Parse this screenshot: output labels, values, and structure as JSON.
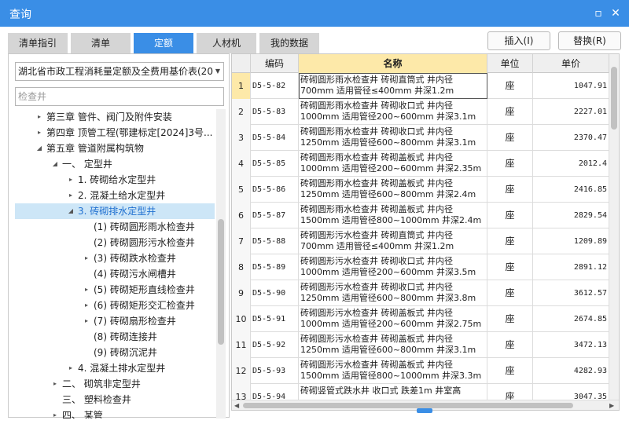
{
  "window": {
    "title": "查询",
    "maximize_glyph": "▫",
    "close_glyph": "✕"
  },
  "tabs": [
    {
      "label": "清单指引",
      "active": false
    },
    {
      "label": "清单",
      "active": false
    },
    {
      "label": "定额",
      "active": true
    },
    {
      "label": "人材机",
      "active": false
    },
    {
      "label": "我的数据",
      "active": false
    }
  ],
  "actions": {
    "insert_label": "插入(I)",
    "replace_label": "替换(R)"
  },
  "left": {
    "library_select": "湖北省市政工程消耗量定额及全费用基价表(20",
    "search_placeholder": "检查井",
    "tree": [
      {
        "label": "第三章 管件、阀门及附件安装",
        "expander": "▸"
      },
      {
        "label": "第四章 顶管工程(鄂建标定[2024]3号...",
        "expander": "▸"
      },
      {
        "label": "第五章 管道附属构筑物",
        "expander": "◢"
      },
      {
        "label": "一、 定型井",
        "expander": "◢"
      },
      {
        "label": "1. 砖砌给水定型井",
        "expander": "▸"
      },
      {
        "label": "2. 混凝土给水定型井",
        "expander": "▸"
      },
      {
        "label": "3. 砖砌排水定型井",
        "expander": "◢",
        "selected": true
      },
      {
        "label": "(1) 砖砌圆形雨水检查井",
        "expander": ""
      },
      {
        "label": "(2) 砖砌圆形污水检查井",
        "expander": ""
      },
      {
        "label": "(3) 砖砌跌水检查井",
        "expander": "▸"
      },
      {
        "label": "(4) 砖砌污水闸槽井",
        "expander": ""
      },
      {
        "label": "(5) 砖砌矩形直线检查井",
        "expander": "▸"
      },
      {
        "label": "(6) 砖砌矩形交汇检查井",
        "expander": "▸"
      },
      {
        "label": "(7) 砖砌扇形检查井",
        "expander": "▸"
      },
      {
        "label": "(8) 砖砌连接井",
        "expander": ""
      },
      {
        "label": "(9) 砖砌沉泥井",
        "expander": ""
      },
      {
        "label": "4. 混凝土排水定型井",
        "expander": "▸"
      },
      {
        "label": "二、 砌筑非定型井",
        "expander": "▸"
      },
      {
        "label": "三、 塑料检查井",
        "expander": ""
      },
      {
        "label": "四、 某管",
        "expander": "▸"
      }
    ]
  },
  "grid": {
    "columns": {
      "no": "",
      "code": "编码",
      "name": "名称",
      "unit": "单位",
      "price": "单价"
    },
    "rows": [
      {
        "no": "1",
        "code": "D5-5-82",
        "name1": "砖砌圆形雨水检查井 砖砌直筒式 井内径",
        "name2": "700mm 适用管径≤400mm 井深1.2m",
        "unit": "座",
        "price": "1047.91"
      },
      {
        "no": "2",
        "code": "D5-5-83",
        "name1": "砖砌圆形雨水检查井 砖砌收口式 井内径",
        "name2": "1000mm 适用管径200~600mm 井深3.1m",
        "unit": "座",
        "price": "2227.01"
      },
      {
        "no": "3",
        "code": "D5-5-84",
        "name1": "砖砌圆形雨水检查井 砖砌收口式 井内径",
        "name2": "1250mm 适用管径600~800mm 井深3.1m",
        "unit": "座",
        "price": "2370.47"
      },
      {
        "no": "4",
        "code": "D5-5-85",
        "name1": "砖砌圆形雨水检查井 砖砌盖板式 井内径",
        "name2": "1000mm 适用管径200~600mm 井深2.35m",
        "unit": "座",
        "price": "2012.4"
      },
      {
        "no": "5",
        "code": "D5-5-86",
        "name1": "砖砌圆形雨水检查井 砖砌盖板式 井内径",
        "name2": "1250mm 适用管径600~800mm 井深2.4m",
        "unit": "座",
        "price": "2416.85"
      },
      {
        "no": "6",
        "code": "D5-5-87",
        "name1": "砖砌圆形雨水检查井 砖砌盖板式 井内径",
        "name2": "1500mm 适用管径800~1000mm 井深2.4m",
        "unit": "座",
        "price": "2829.54"
      },
      {
        "no": "7",
        "code": "D5-5-88",
        "name1": "砖砌圆形污水检查井 砖砌直筒式 井内径",
        "name2": "700mm 适用管径≤400mm 井深1.2m",
        "unit": "座",
        "price": "1209.89"
      },
      {
        "no": "8",
        "code": "D5-5-89",
        "name1": "砖砌圆形污水检查井 砖砌收口式 井内径",
        "name2": "1000mm 适用管径200~600mm 井深3.5m",
        "unit": "座",
        "price": "2891.12"
      },
      {
        "no": "9",
        "code": "D5-5-90",
        "name1": "砖砌圆形污水检查井 砖砌收口式 井内径",
        "name2": "1250mm 适用管径600~800mm 井深3.8m",
        "unit": "座",
        "price": "3612.57"
      },
      {
        "no": "10",
        "code": "D5-5-91",
        "name1": "砖砌圆形污水检查井 砖砌盖板式 井内径",
        "name2": "1000mm 适用管径200~600mm 井深2.75m",
        "unit": "座",
        "price": "2674.85"
      },
      {
        "no": "11",
        "code": "D5-5-92",
        "name1": "砖砌圆形污水检查井 砖砌盖板式 井内径",
        "name2": "1250mm 适用管径600~800mm 井深3.1m",
        "unit": "座",
        "price": "3472.13"
      },
      {
        "no": "12",
        "code": "D5-5-93",
        "name1": "砖砌圆形污水检查井 砖砌盖板式 井内径",
        "name2": "1500mm 适用管径800~1000mm 井深3.3m",
        "unit": "座",
        "price": "4282.93"
      },
      {
        "no": "13",
        "code": "D5-5-94",
        "name1": "砖砌竖管式跌水井 收口式 跌差1m 井室高",
        "name2": "",
        "unit": "座",
        "price": "3047.35"
      }
    ]
  },
  "colors": {
    "accent": "#3a8ee6",
    "header_highlight": "#fde9a9",
    "tree_selection": "#cde6f7"
  }
}
